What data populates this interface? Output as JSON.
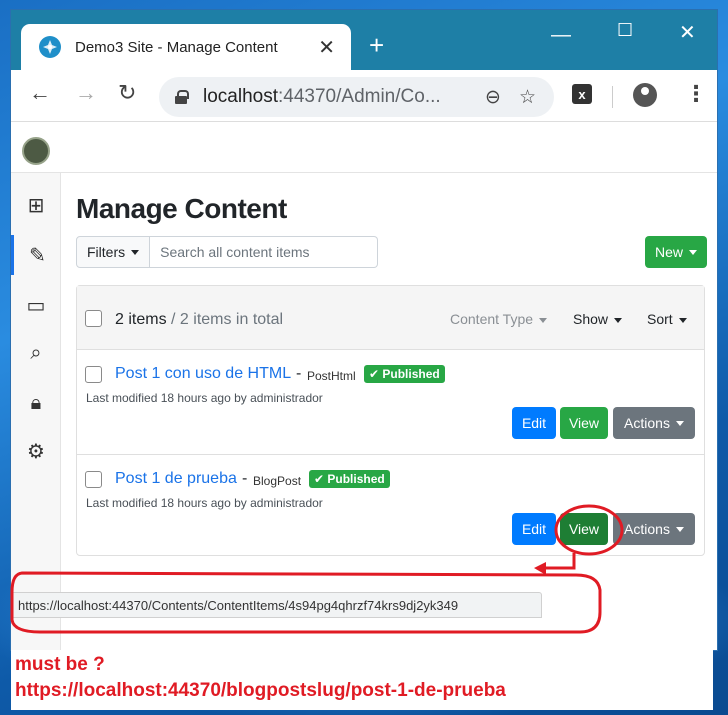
{
  "browser": {
    "tab_title": "Demo3 Site - Manage Content",
    "tab_close": "✕",
    "new_tab": "+",
    "url_host": "localhost",
    "url_rest": ":44370/Admin/Co...",
    "status_url": "https://localhost:44370/Contents/ContentItems/4s94pg4qhrzf74krs9dj2yk349",
    "extension_label": "x"
  },
  "page": {
    "title": "Manage Content",
    "filters_label": "Filters",
    "search_placeholder": "Search all content items",
    "new_label": "New",
    "count_items": "2 items",
    "count_total": " / 2 items in total",
    "content_type_label": "Content Type",
    "show_label": "Show",
    "sort_label": "Sort"
  },
  "items": [
    {
      "title": "Post 1 con uso de HTML",
      "content_type": "PostHtml",
      "status": "Published",
      "modified": "Last modified 18 hours ago by administrador",
      "edit_label": "Edit",
      "view_label": "View",
      "actions_label": "Actions"
    },
    {
      "title": "Post 1 de prueba",
      "content_type": "BlogPost",
      "status": "Published",
      "modified": "Last modified 18 hours ago by administrador",
      "edit_label": "Edit",
      "view_label": "View",
      "actions_label": "Actions"
    }
  ],
  "annotation": {
    "line1": "must be ?",
    "line2": "https://localhost:44370/blogpostslug/post-1-de-prueba",
    "color": "#e01b24"
  },
  "colors": {
    "titlebar": "#1e7fa6",
    "primary": "#007bff",
    "success": "#28a745",
    "secondary": "#6c757d"
  },
  "sidebar_icons": [
    "plus-square-icon",
    "edit-icon",
    "monitor-icon",
    "search-icon",
    "lock-icon",
    "gear-icon"
  ]
}
